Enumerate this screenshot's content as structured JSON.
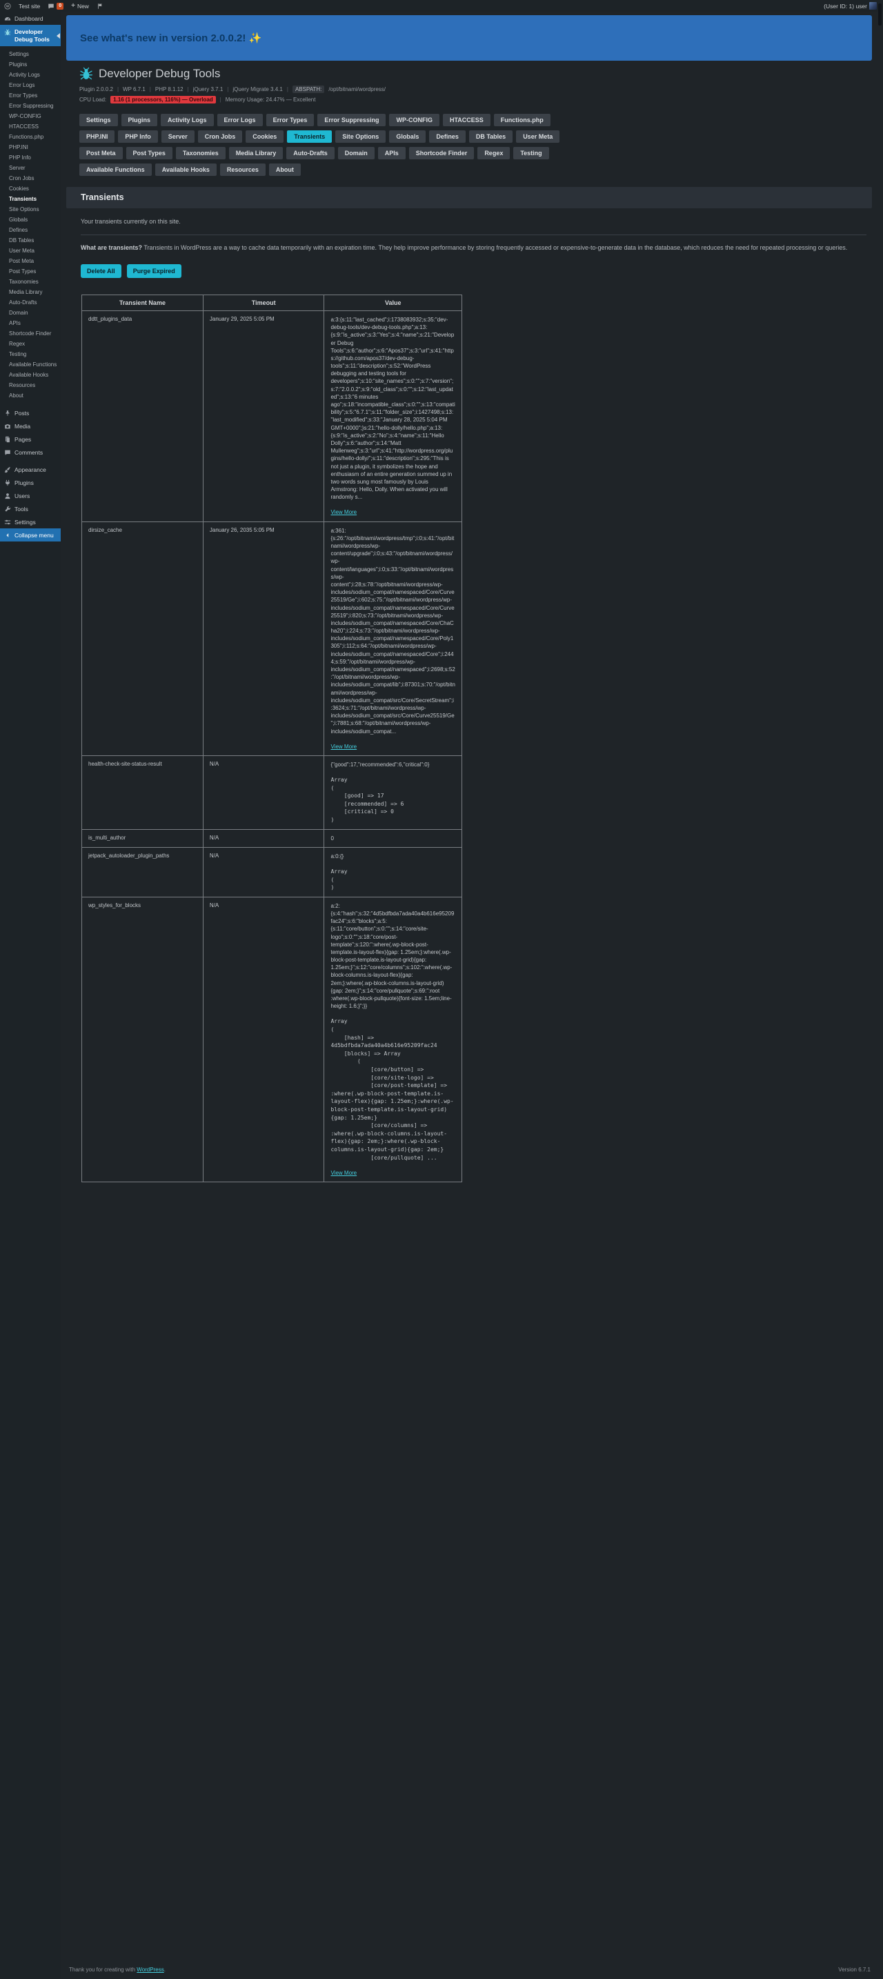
{
  "admin_bar": {
    "site_name": "Test site",
    "comments_count": "0",
    "new_label": "New",
    "user_greeting": "(User ID: 1) user"
  },
  "sidebar": {
    "dashboard": "Dashboard",
    "plugin_menu": "Developer Debug Tools",
    "active_submenu": "Transients",
    "submenu": [
      "Settings",
      "Plugins",
      "Activity Logs",
      "Error Logs",
      "Error Types",
      "Error Suppressing",
      "WP-CONFIG",
      "HTACCESS",
      "Functions.php",
      "PHP.INI",
      "PHP Info",
      "Server",
      "Cron Jobs",
      "Cookies",
      "Transients",
      "Site Options",
      "Globals",
      "Defines",
      "DB Tables",
      "User Meta",
      "Post Meta",
      "Post Types",
      "Taxonomies",
      "Media Library",
      "Auto-Drafts",
      "Domain",
      "APIs",
      "Shortcode Finder",
      "Regex",
      "Testing",
      "Available Functions",
      "Available Hooks",
      "Resources",
      "About"
    ],
    "menu_items": [
      "Posts",
      "Media",
      "Pages",
      "Comments",
      "Appearance",
      "Plugins",
      "Users",
      "Tools",
      "Settings"
    ],
    "collapse": "Collapse menu"
  },
  "banner": {
    "text": "See what's new in version 2.0.0.2! ✨"
  },
  "header": {
    "title": "Developer Debug Tools",
    "separator": "|",
    "meta": [
      "Plugin 2.0.0.2",
      "WP 6.7.1",
      "PHP 8.1.12",
      "jQuery 3.7.1",
      "jQuery Migrate 3.4.1"
    ],
    "abspath_label": "ABSPATH:",
    "abspath_value": "/opt/bitnami/wordpress/",
    "cpu_label": "CPU Load:",
    "cpu_value": "1.16 (1 processors, 116%) — Overload",
    "memory": "Memory Usage: 24.47% — Excellent"
  },
  "tabs": {
    "active": "Transients",
    "items": [
      "Settings",
      "Plugins",
      "Activity Logs",
      "Error Logs",
      "Error Types",
      "Error Suppressing",
      "WP-CONFIG",
      "HTACCESS",
      "Functions.php",
      "PHP.INI",
      "PHP Info",
      "Server",
      "Cron Jobs",
      "Cookies",
      "Transients",
      "Site Options",
      "Globals",
      "Defines",
      "DB Tables",
      "User Meta",
      "Post Meta",
      "Post Types",
      "Taxonomies",
      "Media Library",
      "Auto-Drafts",
      "Domain",
      "APIs",
      "Shortcode Finder",
      "Regex",
      "Testing",
      "Available Functions",
      "Available Hooks",
      "Resources",
      "About"
    ]
  },
  "section": {
    "title": "Transients",
    "subtitle": "Your transients currently on this site.",
    "description_bold": "What are transients?",
    "description_rest": " Transients in WordPress are a way to cache data temporarily with an expiration time. They help improve performance by storing frequently accessed or expensive-to-generate data in the database, which reduces the need for repeated processing or queries.",
    "delete_all_label": "Delete All",
    "purge_expired_label": "Purge Expired"
  },
  "table": {
    "headers": [
      "Transient Name",
      "Timeout",
      "Value"
    ],
    "view_more": "View More",
    "rows": [
      {
        "name": "ddtt_plugins_data",
        "timeout": "January 29, 2025 5:05 PM",
        "value": "a:3:{s:11:\"last_cached\";i:1738083932;s:35:\"dev-debug-tools/dev-debug-tools.php\";a:13:{s:9:\"is_active\";s:3:\"Yes\";s:4:\"name\";s:21:\"Developer Debug Tools\";s:6:\"author\";s:6:\"Apos37\";s:3:\"url\";s:41:\"https://github.com/apos37/dev-debug-tools\";s:11:\"description\";s:52:\"WordPress debugging and testing tools for developers\";s:10:\"site_names\";s:0:\"\";s:7:\"version\";s:7:\"2.0.0.2\";s:9:\"old_class\";s:0:\"\";s:12:\"last_updated\";s:13:\"6 minutes ago\";s:18:\"incompatible_class\";s:0:\"\";s:13:\"compatibility\";s:5:\"6.7.1\";s:11:\"folder_size\";i:1427498;s:13:\"last_modified\";s:33:\"January 28, 2025 5:04 PM GMT+0000\";}s:21:\"hello-dolly/hello.php\";a:13:{s:9:\"is_active\";s:2:\"No\";s:4:\"name\";s:11:\"Hello Dolly\";s:6:\"author\";s:14:\"Matt Mullenweg\";s:3:\"url\";s:41:\"http://wordpress.org/plugins/hello-dolly/\";s:11:\"description\";s:295:\"This is not just a plugin, it symbolizes the hope and enthusiasm of an entire generation summed up in two words sung most famously by Louis Armstrong: Hello, Dolly. When activated you will randomly s...",
        "pre": null,
        "view_more": true
      },
      {
        "name": "dirsize_cache",
        "timeout": "January 26, 2035 5:05 PM",
        "value": "a:361:{s:26:\"/opt/bitnami/wordpress/tmp\";i:0;s:41:\"/opt/bitnami/wordpress/wp-content/upgrade\";i:0;s:43:\"/opt/bitnami/wordpress/wp-content/languages\";i:0;s:33:\"/opt/bitnami/wordpress/wp-content\";i:28;s:78:\"/opt/bitnami/wordpress/wp-includes/sodium_compat/namespaced/Core/Curve25519/Ge\";i:602;s:75:\"/opt/bitnami/wordpress/wp-includes/sodium_compat/namespaced/Core/Curve25519\";i:820;s:73:\"/opt/bitnami/wordpress/wp-includes/sodium_compat/namespaced/Core/ChaCha20\";i:224;s:73:\"/opt/bitnami/wordpress/wp-includes/sodium_compat/namespaced/Core/Poly1305\";i:112;s:64:\"/opt/bitnami/wordpress/wp-includes/sodium_compat/namespaced/Core\";i:2444;s:59:\"/opt/bitnami/wordpress/wp-includes/sodium_compat/namespaced\";i:2698;s:52:\"/opt/bitnami/wordpress/wp-includes/sodium_compat/lib\";i:87301;s:70:\"/opt/bitnami/wordpress/wp-includes/sodium_compat/src/Core/SecretStream\";i:3624;s:71:\"/opt/bitnami/wordpress/wp-includes/sodium_compat/src/Core/Curve25519/Ge\";i:7881;s:68:\"/opt/bitnami/wordpress/wp-includes/sodium_compat...",
        "pre": null,
        "view_more": true
      },
      {
        "name": "health-check-site-status-result",
        "timeout": "N/A",
        "value": "{\"good\":17,\"recommended\":6,\"critical\":0}",
        "pre": "Array\n(\n    [good] => 17\n    [recommended] => 6\n    [critical] => 0\n)",
        "view_more": false
      },
      {
        "name": "is_multi_author",
        "timeout": "N/A",
        "value": "0",
        "pre": null,
        "view_more": false
      },
      {
        "name": "jetpack_autoloader_plugin_paths",
        "timeout": "N/A",
        "value": "a:0:{}",
        "pre": "Array\n(\n)",
        "view_more": false
      },
      {
        "name": "wp_styles_for_blocks",
        "timeout": "N/A",
        "value": "a:2:{s:4:\"hash\";s:32:\"4d5bdfbda7ada40a4b616e95209fac24\";s:6:\"blocks\";a:5:{s:11:\"core/button\";s:0:\"\";s:14:\"core/site-logo\";s:0:\"\";s:18:\"core/post-template\";s:120:\":where(.wp-block-post-template.is-layout-flex){gap: 1.25em;}:where(.wp-block-post-template.is-layout-grid){gap: 1.25em;}\";s:12:\"core/columns\";s:102:\":where(.wp-block-columns.is-layout-flex){gap: 2em;}:where(.wp-block-columns.is-layout-grid){gap: 2em;}\";s:14:\"core/pullquote\";s:69:\":root :where(.wp-block-pullquote){font-size: 1.5em;line-height: 1.6;}\";}}",
        "pre": "Array\n(\n    [hash] => 4d5bdfbda7ada40a4b616e95209fac24\n    [blocks] => Array\n        (\n            [core/button] => \n            [core/site-logo] => \n            [core/post-template] => :where(.wp-block-post-template.is-layout-flex){gap: 1.25em;}:where(.wp-block-post-template.is-layout-grid){gap: 1.25em;}\n            [core/columns] => :where(.wp-block-columns.is-layout-flex){gap: 2em;}:where(.wp-block-columns.is-layout-grid){gap: 2em;}\n            [core/pullquote] ...",
        "view_more": true
      }
    ]
  },
  "footer": {
    "thanks_prefix": "Thank you for creating with ",
    "thanks_link": "WordPress",
    "thanks_suffix": ".",
    "version": "Version 6.7.1"
  }
}
